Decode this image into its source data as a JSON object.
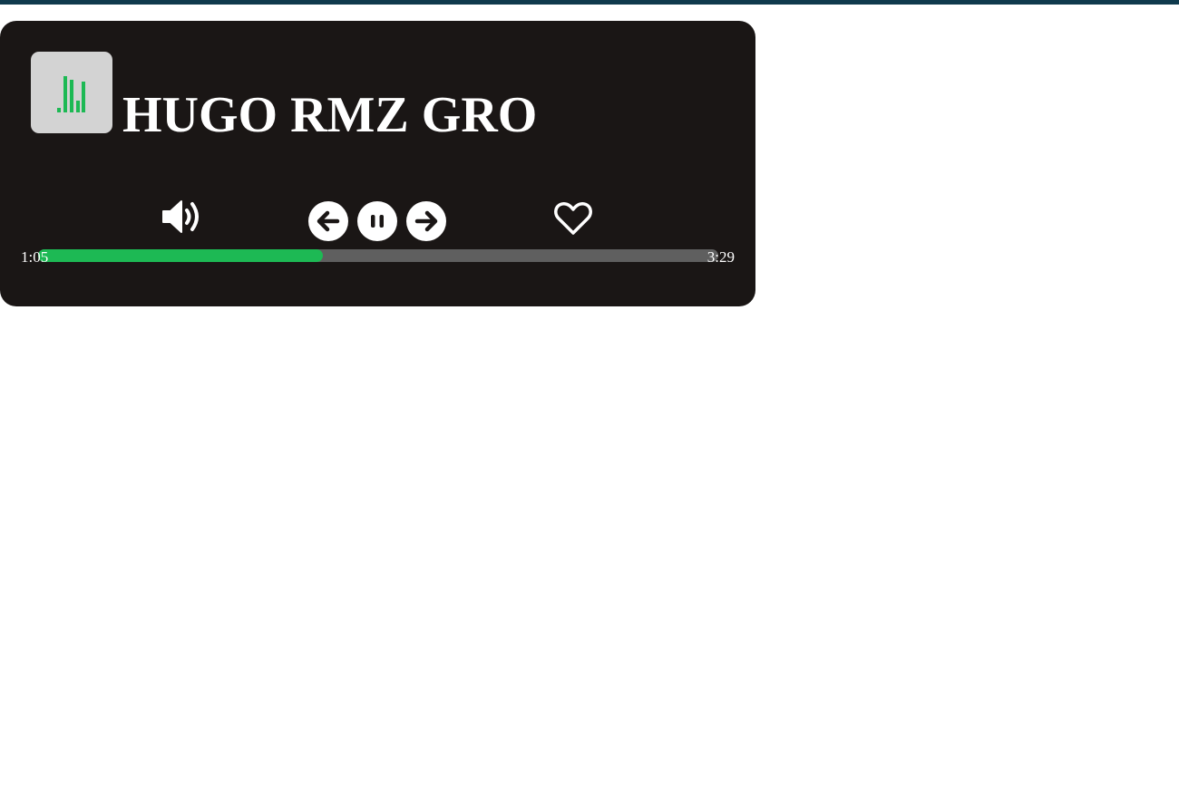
{
  "track": {
    "title": "HUGO RMZ GRO"
  },
  "controls": {
    "volume_icon": "volume-up-icon",
    "prev_icon": "arrow-left-circle-icon",
    "pause_icon": "pause-circle-icon",
    "next_icon": "arrow-right-circle-icon",
    "like_icon": "heart-outline-icon"
  },
  "progress": {
    "elapsed": "1:05",
    "total": "3:29",
    "fraction": 0.418
  },
  "colors": {
    "player_bg": "#1a1615",
    "accent": "#1db954",
    "track_bg": "#5f5f5f",
    "album_bg": "#d3d3d3",
    "text": "#ffffff",
    "top_stripe": "#0f3a4d"
  }
}
